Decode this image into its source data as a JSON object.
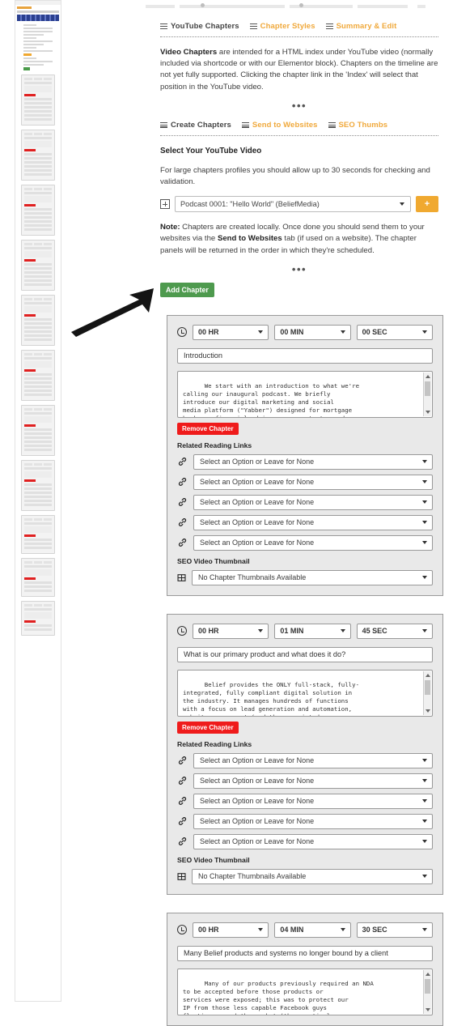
{
  "colors": {
    "accent_orange": "#f0a93c",
    "add_green": "#4e9a4e",
    "remove_red": "#ef1b1b",
    "panel_bg": "#e9e9e9",
    "panel_border": "#9a9a9a"
  },
  "nav_primary": {
    "items": [
      {
        "label": "YouTube Chapters",
        "icon": "hamburger-icon",
        "active": true
      },
      {
        "label": "Chapter Styles",
        "icon": "hamburger-icon",
        "active": false
      },
      {
        "label": "Summary & Edit",
        "icon": "hamburger-icon",
        "active": false
      }
    ]
  },
  "intro": {
    "lead": "Video Chapters",
    "text": " are intended for a HTML index under YouTube video (normally included via shortcode or with our Elementor block). Chapters on the timeline are not yet fully supported. Clicking the chapter link in the 'Index' will select that position in the YouTube video.",
    "ellipsis": "•••"
  },
  "nav_secondary": {
    "items": [
      {
        "label": "Create Chapters",
        "icon": "hamburger-icon",
        "active": true
      },
      {
        "label": "Send to Websites",
        "icon": "hamburger-icon",
        "active": false
      },
      {
        "label": "SEO Thumbs",
        "icon": "hamburger-icon",
        "active": false
      }
    ]
  },
  "video_section": {
    "heading": "Select Your YouTube Video",
    "description": "For large chapters profiles you should allow up to 30 seconds for checking and validation.",
    "select_value": "Podcast 0001: \"Hello World\" (BeliefMedia)",
    "add_button_label": "+",
    "note_lead": "Note:",
    "note_text_a": " Chapters are created locally. Once done you should send them to your websites via the ",
    "note_bold_b": "Send to Websites",
    "note_text_c": " tab (if used on a website). The chapter panels will be returned in the order in which they're scheduled.",
    "ellipsis": "•••",
    "add_chapter_label": "Add Chapter"
  },
  "labels": {
    "related_reading_links": "Related Reading Links",
    "seo_video_thumbnail": "SEO Video Thumbnail",
    "remove_chapter": "Remove Chapter",
    "link_select_placeholder": "Select an Option or Leave for None",
    "thumbnail_select_value": "No Chapter Thumbnails Available"
  },
  "chapters": [
    {
      "hours": "00 HR",
      "minutes": "00 MIN",
      "seconds": "00 SEC",
      "title": "Introduction",
      "description": "We start with an introduction to what we're\ncalling our inaugural podcast. We briefly\nintroduce our digital marketing and social\nmedia platform (\"Yabber\") designed for mortgage\nbrokers, financial advisers, accountants, and\nreal estate agents.",
      "link_count": 5,
      "thumbnail": "No Chapter Thumbnails Available"
    },
    {
      "hours": "00 HR",
      "minutes": "01 MIN",
      "seconds": "45 SEC",
      "title": "What is our primary product and what does it do?",
      "description": "Belief provides the ONLY full-stack, fully-\nintegrated, fully compliant digital solution in\nthe industry. It manages hundreds of functions\nwith a focus on lead generation and automation,\nwebsite management (and the associated user\nexperience), email marketing, social media, and",
      "link_count": 5,
      "thumbnail": "No Chapter Thumbnails Available"
    },
    {
      "hours": "00 HR",
      "minutes": "04 MIN",
      "seconds": "30 SEC",
      "title": "Many Belief products and systems no longer bound by a client",
      "description": "Many of our products previously required an NDA\nto be accepted before those products or\nservices were exposed; this was to protect our\nIP from those less capable Facebook guys\nfloating around the market (they routinely",
      "link_count": 0,
      "thumbnail": ""
    }
  ],
  "annotation": {
    "arrow": "black-arrow-pointing-to-first-chapter-panel"
  },
  "minimap": {
    "name": "page-thumbnail-minimap"
  }
}
